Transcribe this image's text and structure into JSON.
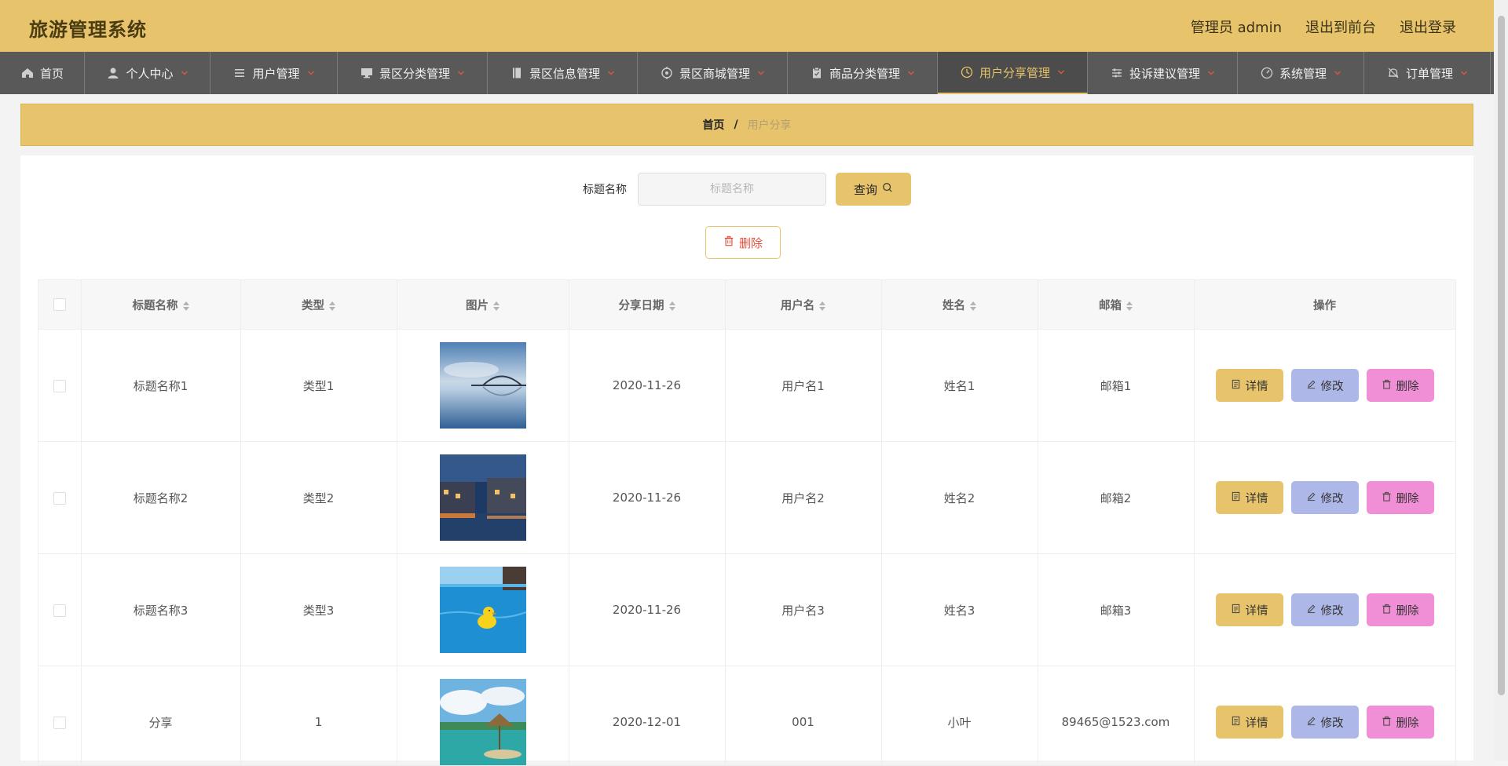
{
  "header": {
    "title": "旅游管理系统",
    "user": "管理员 admin",
    "front": "退出到前台",
    "logout": "退出登录"
  },
  "nav": [
    {
      "label": "首页",
      "icon": "home-icon",
      "width": 108
    },
    {
      "label": "个人中心",
      "icon": "user-icon",
      "width": 160
    },
    {
      "label": "用户管理",
      "icon": "list-icon",
      "width": 162
    },
    {
      "label": "景区分类管理",
      "icon": "monitor-icon",
      "width": 191
    },
    {
      "label": "景区信息管理",
      "icon": "notebook-icon",
      "width": 191
    },
    {
      "label": "景区商城管理",
      "icon": "target-icon",
      "width": 191
    },
    {
      "label": "商品分类管理",
      "icon": "clipboard-icon",
      "width": 191
    },
    {
      "label": "用户分享管理",
      "icon": "clock-icon",
      "width": 191,
      "active": true
    },
    {
      "label": "投诉建议管理",
      "icon": "sliders-icon",
      "width": 191
    },
    {
      "label": "系统管理",
      "icon": "gauge-icon",
      "width": 161
    },
    {
      "label": "订单管理",
      "icon": "bell-icon",
      "width": 161
    }
  ],
  "breadcrumb": {
    "home": "首页",
    "sep": "/",
    "current": "用户分享"
  },
  "search": {
    "label": "标题名称",
    "placeholder": "标题名称",
    "value": "",
    "button": "查询"
  },
  "bulk_delete": "删除",
  "table": {
    "columns": [
      "标题名称",
      "类型",
      "图片",
      "分享日期",
      "用户名",
      "姓名",
      "邮箱",
      "操作"
    ],
    "rows": [
      {
        "title": "标题名称1",
        "type": "类型1",
        "image": "bridge-lake-photo",
        "date": "2020-11-26",
        "username": "用户名1",
        "name": "姓名1",
        "email": "邮箱1"
      },
      {
        "title": "标题名称2",
        "type": "类型2",
        "image": "canal-town-night-photo",
        "date": "2020-11-26",
        "username": "用户名2",
        "name": "姓名2",
        "email": "邮箱2"
      },
      {
        "title": "标题名称3",
        "type": "类型3",
        "image": "pool-rubber-duck-photo",
        "date": "2020-11-26",
        "username": "用户名3",
        "name": "姓名3",
        "email": "邮箱3"
      },
      {
        "title": "分享",
        "type": "1",
        "image": "beach-hut-photo",
        "date": "2020-12-01",
        "username": "001",
        "name": "小叶",
        "email": "89465@1523.com"
      }
    ],
    "actions": {
      "detail": "详情",
      "edit": "修改",
      "delete": "删除"
    }
  },
  "colors": {
    "accent": "#e7c46c",
    "nav_bg": "#595959",
    "edit": "#aeb8e8",
    "delete": "#f08fd6"
  }
}
